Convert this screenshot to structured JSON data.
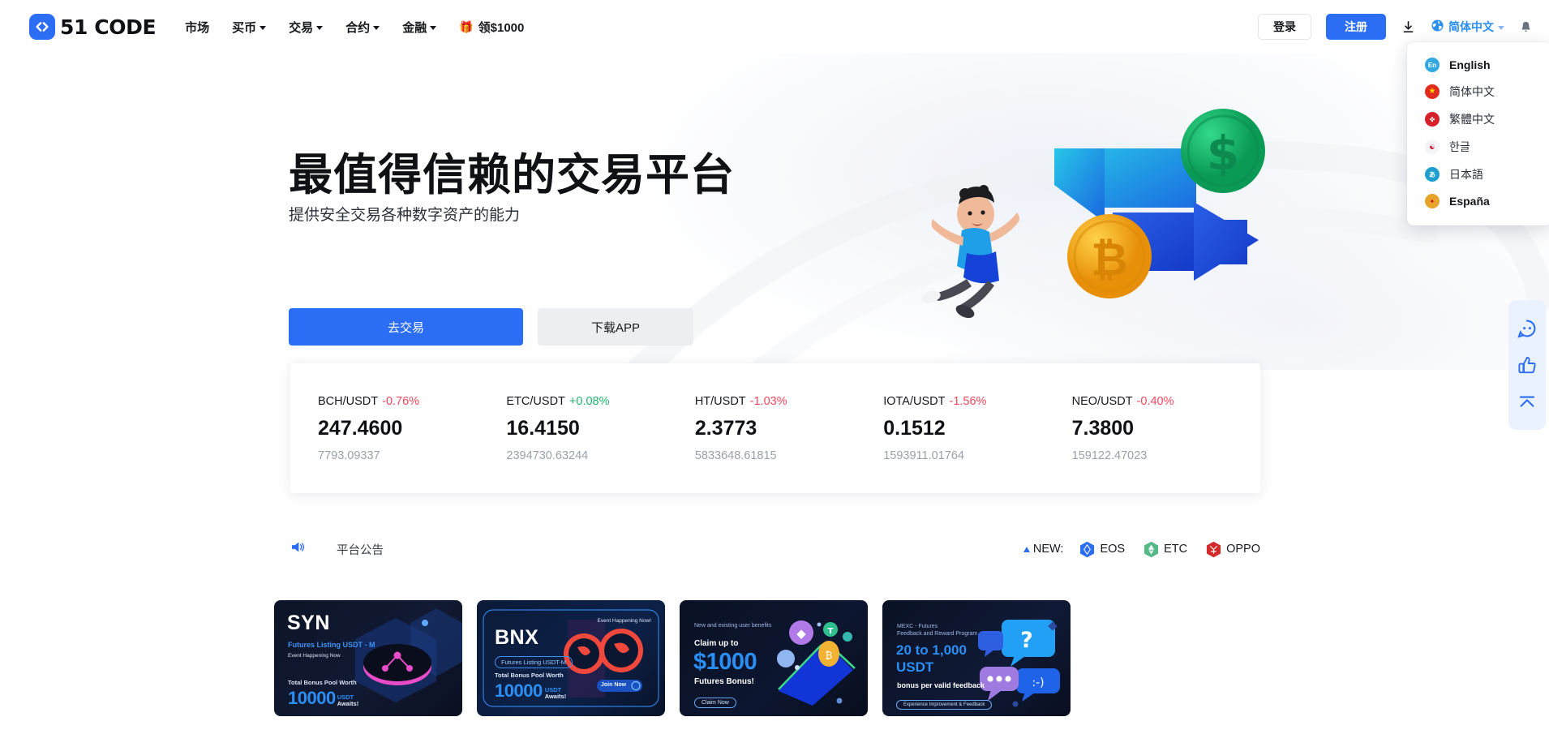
{
  "brand": {
    "name": "51 CODE",
    "logo_icon": "code-brackets-icon",
    "accent": "#2b6df5"
  },
  "nav": {
    "items": [
      {
        "label": "市场",
        "caret": false
      },
      {
        "label": "买币",
        "caret": true
      },
      {
        "label": "交易",
        "caret": true
      },
      {
        "label": "合约",
        "caret": true
      },
      {
        "label": "金融",
        "caret": true
      }
    ],
    "promo": {
      "icon": "gift-icon",
      "glyph": "🎁",
      "label": "领$1000"
    }
  },
  "header_right": {
    "login_label": "登录",
    "register_label": "注册",
    "download_icon": "download-icon",
    "language_label": "简体中文",
    "globe_icon": "globe-icon",
    "bell_icon": "bell-icon"
  },
  "language_menu": {
    "items": [
      {
        "label": "English",
        "flag": "flag-en",
        "glyph": "En",
        "bold": true
      },
      {
        "label": "简体中文",
        "flag": "flag-cn",
        "glyph": "★",
        "bold": false
      },
      {
        "label": "繁體中文",
        "flag": "flag-hk",
        "glyph": "✤",
        "bold": false
      },
      {
        "label": "한글",
        "flag": "flag-kr",
        "glyph": "☯",
        "bold": false
      },
      {
        "label": "日本語",
        "flag": "flag-jp",
        "glyph": "あ",
        "bold": false
      },
      {
        "label": "España",
        "flag": "flag-es",
        "glyph": "✦",
        "bold": true
      }
    ]
  },
  "hero": {
    "title": "最值得信赖的交易平台",
    "subtitle": "提供安全交易各种数字资产的能力",
    "cta_primary": "去交易",
    "cta_secondary": "下载APP",
    "illustration": "crypto-exchange-illustration"
  },
  "tickers": [
    {
      "pair": "BCH/USDT",
      "change": "-0.76%",
      "direction": "down",
      "price": "247.4600",
      "volume": "7793.09337"
    },
    {
      "pair": "ETC/USDT",
      "change": "+0.08%",
      "direction": "up",
      "price": "16.4150",
      "volume": "2394730.63244"
    },
    {
      "pair": "HT/USDT",
      "change": "-1.03%",
      "direction": "down",
      "price": "2.3773",
      "volume": "5833648.61815"
    },
    {
      "pair": "IOTA/USDT",
      "change": "-1.56%",
      "direction": "down",
      "price": "0.1512",
      "volume": "1593911.01764"
    },
    {
      "pair": "NEO/USDT",
      "change": "-0.40%",
      "direction": "down",
      "price": "7.3800",
      "volume": "159122.47023"
    }
  ],
  "announcement": {
    "icon": "megaphone-icon",
    "label": "平台公告",
    "new_label": "NEW:",
    "coins": [
      {
        "symbol": "EOS",
        "color": "#2b6df5"
      },
      {
        "symbol": "ETC",
        "color": "#53b987"
      },
      {
        "symbol": "OPPO",
        "color": "#d32b2b"
      }
    ]
  },
  "banners": [
    {
      "id": "syn",
      "title": "SYN",
      "subtitle": "Futures Listing USDT - M",
      "note": "Event Happening Now",
      "bonus_label": "Total Bonus Pool Worth",
      "amount": "10000",
      "unit_top": "USDT",
      "unit_bottom": "Awaits!"
    },
    {
      "id": "bnx",
      "title": "BNX",
      "subtitle": "Futures Listing USDT-M",
      "note": "Event Happening Now!",
      "bonus_label": "Total Bonus Pool Worth",
      "amount": "10000",
      "unit_top": "USDT",
      "unit_bottom": "Awaits!",
      "cta": "Join Now"
    },
    {
      "id": "bonus1000",
      "eyebrow": "New and existing user benefits",
      "claim_label": "Claim up to",
      "amount": "$1000",
      "note": "Futures Bonus!",
      "cta": "Claim Now"
    },
    {
      "id": "feedback",
      "eyebrow": "MEXC - Futures\nFeedback and Reward Program",
      "amount_line1": "20 to 1,000",
      "amount_line2": "USDT",
      "note": "bonus per valid feedback",
      "cta": "Experience Improvement & Feedback"
    }
  ],
  "side_widget": {
    "items": [
      {
        "icon": "chat-support-icon"
      },
      {
        "icon": "thumbs-up-icon"
      },
      {
        "icon": "scroll-to-top-icon"
      }
    ]
  }
}
